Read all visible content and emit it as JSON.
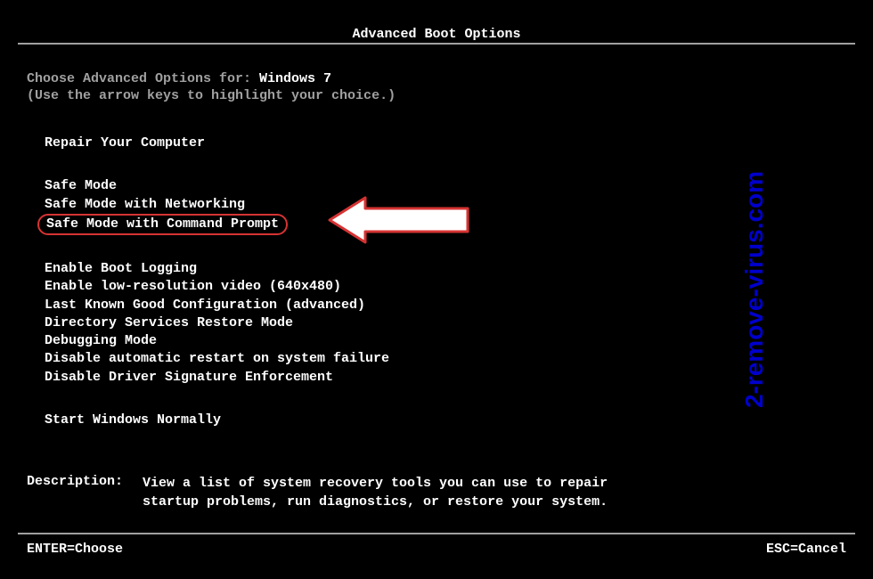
{
  "title": "Advanced Boot Options",
  "choose_prefix": "Choose Advanced Options for: ",
  "windows_version": "Windows 7",
  "hint": "(Use the arrow keys to highlight your choice.)",
  "groups": {
    "g1": {
      "items": [
        "Repair Your Computer"
      ]
    },
    "g2": {
      "items": [
        "Safe Mode",
        "Safe Mode with Networking",
        "Safe Mode with Command Prompt"
      ]
    },
    "g3": {
      "items": [
        "Enable Boot Logging",
        "Enable low-resolution video (640x480)",
        "Last Known Good Configuration (advanced)",
        "Directory Services Restore Mode",
        "Debugging Mode",
        "Disable automatic restart on system failure",
        "Disable Driver Signature Enforcement"
      ]
    },
    "g4": {
      "items": [
        "Start Windows Normally"
      ]
    }
  },
  "description_label": "Description:",
  "description_text": "View a list of system recovery tools you can use to repair startup problems, run diagnostics, or restore your system.",
  "bottom": {
    "enter": "ENTER=Choose",
    "esc": "ESC=Cancel"
  },
  "watermark": "2-remove-virus.com"
}
